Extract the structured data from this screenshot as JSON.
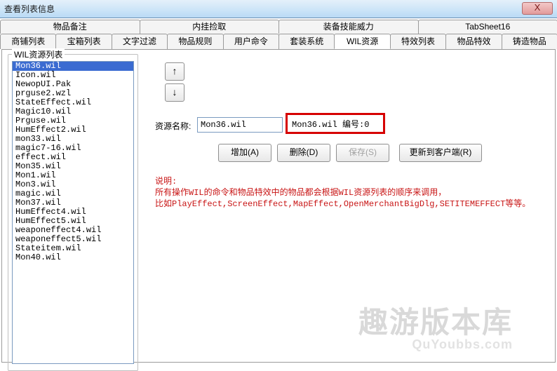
{
  "window": {
    "title": "查看列表信息",
    "close": "X"
  },
  "tabs_row1": {
    "t0": "物品备注",
    "t1": "内挂捡取",
    "t2": "装备技能威力",
    "t3": "TabSheet16"
  },
  "tabs_row2": {
    "t0": "商铺列表",
    "t1": "宝箱列表",
    "t2": "文字过滤",
    "t3": "物品规则",
    "t4": "用户命令",
    "t5": "套装系统",
    "t6": "WIL资源",
    "t7": "特效列表",
    "t8": "物品特效",
    "t9": "铸造物品"
  },
  "group": {
    "title": "WIL资源列表"
  },
  "list": {
    "i0": "Mon36.wil",
    "i1": "Icon.wil",
    "i2": "NewopUI.Pak",
    "i3": "prguse2.wzl",
    "i4": "StateEffect.wil",
    "i5": "Magic10.wil",
    "i6": "Prguse.wil",
    "i7": "HumEffect2.wil",
    "i8": "mon33.wil",
    "i9": "magic7-16.wil",
    "i10": "effect.wil",
    "i11": "Mon35.wil",
    "i12": "Mon1.wil",
    "i13": "Mon3.wil",
    "i14": "magic.wil",
    "i15": "Mon37.wil",
    "i16": "HumEffect4.wil",
    "i17": "HumEffect5.wil",
    "i18": "weaponeffect4.wil",
    "i19": "weaponeffect5.wil",
    "i20": "Stateitem.wil",
    "i21": "Mon40.wil"
  },
  "arrows": {
    "up": "↑",
    "down": "↓"
  },
  "res": {
    "label": "资源名称:",
    "value": "Mon36.wil",
    "info": "Mon36.wil 编号:0"
  },
  "buttons": {
    "add": "增加(A)",
    "del": "删除(D)",
    "save": "保存(S)",
    "update": "更新到客户端(R)"
  },
  "explain": {
    "title": "说明:",
    "l1": "所有操作WIL的命令和物品特效中的物品都会根据WIL资源列表的顺序来调用，",
    "l2": "比如PlayEffect,ScreenEffect,MapEffect,OpenMerchantBigDlg,SETITEMEFFECT等等。"
  },
  "watermark": {
    "l1": "趣游版本库",
    "l2": "QuYoubbs.com"
  }
}
